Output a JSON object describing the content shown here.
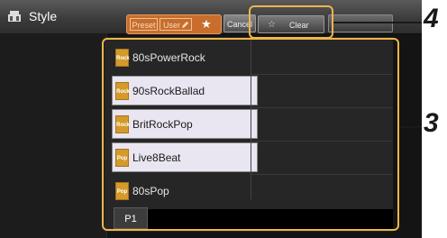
{
  "header": {
    "title": "Style",
    "title_icon": "style-icon",
    "tabs": {
      "preset": "Preset",
      "user": "User",
      "favorite": "★"
    },
    "cancel_label": "Cancel",
    "clear_label": "Clear",
    "clear_icon": "star-outline-icon"
  },
  "styles": [
    {
      "name": "80sPowerRock",
      "badge": "Rock",
      "selected": false
    },
    {
      "name": "90sRockBallad",
      "badge": "Rock",
      "selected": true
    },
    {
      "name": "BritRockPop",
      "badge": "Rock",
      "selected": true
    },
    {
      "name": "Live8Beat",
      "badge": "Pop",
      "selected": true
    },
    {
      "name": "80sPop",
      "badge": "Pop",
      "selected": false
    }
  ],
  "page": {
    "current": "P1"
  },
  "callouts": {
    "clear": "4",
    "list": "3"
  },
  "colors": {
    "accent": "#c86d2b",
    "callout": "#f0b64a",
    "selected_row": "#e9e6f2",
    "background": "#141414"
  }
}
